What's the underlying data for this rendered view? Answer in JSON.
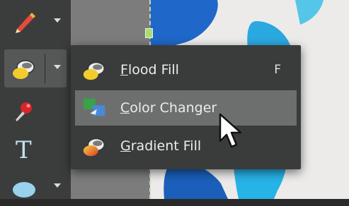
{
  "menu": {
    "items": [
      {
        "label": "Flood Fill",
        "shortcut": "F",
        "icon": "flood-fill-icon"
      },
      {
        "label": "Color Changer",
        "shortcut": "",
        "icon": "color-changer-icon"
      },
      {
        "label": "Gradient Fill",
        "shortcut": "",
        "icon": "gradient-fill-icon"
      }
    ],
    "highlighted_index": 1
  },
  "toolbar": {
    "tools": [
      {
        "icon": "brush-pen-icon",
        "has_dropdown": true
      },
      {
        "icon": "fill-bucket-icon",
        "has_dropdown": true,
        "active": true
      },
      {
        "icon": "eyedropper-icon",
        "has_dropdown": false
      },
      {
        "icon": "text-tool-icon",
        "label": "T",
        "has_dropdown": false
      },
      {
        "icon": "ellipse-shape-icon",
        "has_dropdown": true
      }
    ]
  },
  "colors": {
    "toolbar_bg": "#3b3d3d",
    "menu_bg": "#3a3c3c",
    "highlight": "#6d6f6f",
    "paint_blue": "#1f6fd0",
    "paint_cyan": "#27b4e6"
  }
}
